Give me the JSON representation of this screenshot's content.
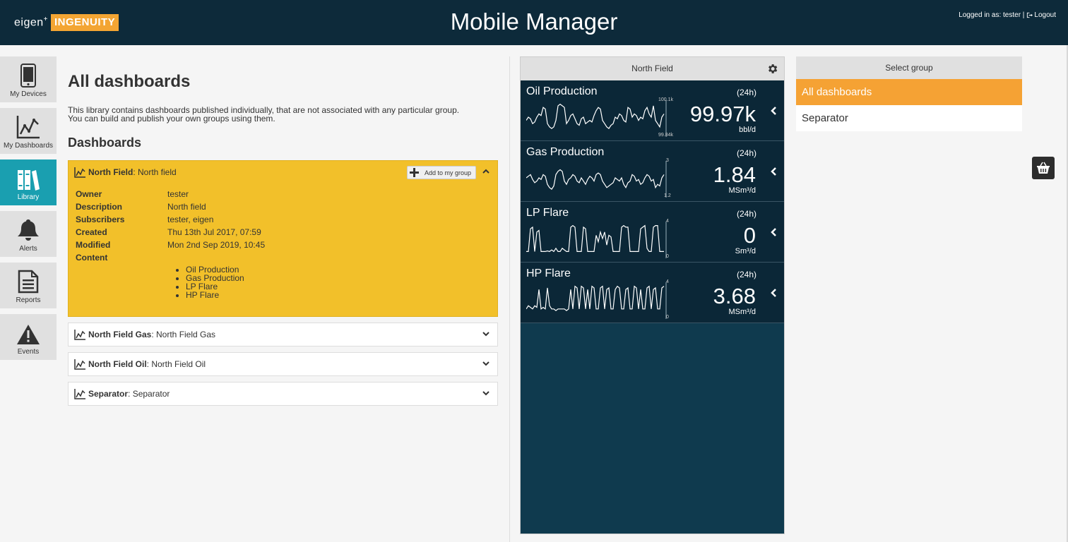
{
  "header": {
    "logo_eigen": "eigen",
    "logo_plus": "+",
    "logo_ingenuity": "INGENUITY",
    "title": "Mobile Manager",
    "logged_in_text": "Logged in as: tester |",
    "logout_label": "Logout"
  },
  "sidebar": {
    "items": [
      {
        "label": "My Devices",
        "icon": "phone-icon",
        "active": false
      },
      {
        "label": "My Dashboards",
        "icon": "line-chart-icon",
        "active": false
      },
      {
        "label": "Library",
        "icon": "books-icon",
        "active": true
      },
      {
        "label": "Alerts",
        "icon": "bell-icon",
        "active": false
      },
      {
        "label": "Reports",
        "icon": "document-icon",
        "active": false
      },
      {
        "label": "Events",
        "icon": "warning-icon",
        "active": false
      }
    ]
  },
  "library": {
    "title": "All dashboards",
    "description_line1": "This library contains dashboards published individually, that are not associated with any particular group.",
    "description_line2": "You can build and publish your own groups using them.",
    "subtitle": "Dashboards",
    "expanded": {
      "name": "North Field",
      "desc": ": North field",
      "add_button": "Add to my group",
      "details": [
        {
          "label": "Owner",
          "value": "tester"
        },
        {
          "label": "Description",
          "value": "North field"
        },
        {
          "label": "Subscribers",
          "value": "tester, eigen"
        },
        {
          "label": "Created",
          "value": "Thu 13th Jul 2017, 07:59"
        },
        {
          "label": "Modified",
          "value": "Mon 2nd Sep 2019, 10:45"
        },
        {
          "label": "Content",
          "value": ""
        }
      ],
      "content": [
        "Oil Production",
        "Gas Production",
        "LP Flare",
        "HP Flare"
      ]
    },
    "collapsed": [
      {
        "name": "North Field Gas",
        "desc": ": North Field Gas"
      },
      {
        "name": "North Field Oil",
        "desc": ": North Field Oil"
      },
      {
        "name": "Separator",
        "desc": ": Separator"
      }
    ]
  },
  "preview": {
    "title": "North Field",
    "widgets": [
      {
        "title": "Oil Production",
        "period": "(24h)",
        "value": "99.97k",
        "unit": "bbl/d",
        "tick_max": "100.1k",
        "tick_min": "99.84k",
        "spark": [
          0.4,
          0.5,
          0.45,
          0.3,
          0.35,
          0.5,
          0.6,
          0.55,
          0.8,
          0.75,
          0.3,
          0.2,
          0.15,
          0.2,
          0.4,
          0.85,
          0.9,
          0.85,
          0.8,
          0.3,
          0.4,
          0.55,
          0.6,
          0.45,
          0.3,
          0.25,
          0.45,
          0.5,
          0.3,
          0.35,
          0.4,
          0.35,
          0.55,
          0.7,
          0.8,
          0.75,
          0.4,
          0.3,
          0.2,
          0.15,
          0.25,
          0.3,
          0.5,
          0.45,
          0.6,
          0.55,
          0.4,
          0.35,
          0.8,
          0.75,
          0.5,
          0.6,
          0.55,
          0.4,
          0.5,
          0.45,
          0.7,
          0.8,
          0.6,
          0.5,
          0.85,
          0.4,
          0.3,
          0.2,
          0.5,
          0.6
        ]
      },
      {
        "title": "Gas Production",
        "period": "(24h)",
        "value": "1.84",
        "unit": "MSm³/d",
        "tick_max": "3",
        "tick_min": "1.2",
        "spark": [
          0.5,
          0.55,
          0.6,
          0.45,
          0.35,
          0.4,
          0.5,
          0.45,
          0.6,
          0.55,
          0.3,
          0.2,
          0.15,
          0.25,
          0.6,
          0.7,
          0.75,
          0.7,
          0.4,
          0.3,
          0.45,
          0.5,
          0.6,
          0.55,
          0.4,
          0.35,
          0.5,
          0.4,
          0.3,
          0.45,
          0.55,
          0.5,
          0.4,
          0.6,
          0.65,
          0.6,
          0.4,
          0.3,
          0.2,
          0.25,
          0.3,
          0.35,
          0.5,
          0.45,
          0.4,
          0.5,
          0.3,
          0.2,
          0.35,
          0.4,
          0.6,
          0.55,
          0.4,
          0.45,
          0.3,
          0.35,
          0.5,
          0.6,
          0.55,
          0.4,
          0.45,
          0.2,
          0.3,
          0.25,
          0.5,
          0.6
        ]
      },
      {
        "title": "LP Flare",
        "period": "(24h)",
        "value": "0",
        "unit": "Sm³/d",
        "tick_max": "4",
        "tick_min": "0",
        "spark": [
          0.1,
          0.1,
          0.8,
          0.85,
          0.1,
          0.7,
          0.75,
          0.1,
          0.1,
          0.1,
          0.12,
          0.1,
          0.15,
          0.1,
          0.2,
          0.1,
          0.1,
          0.2,
          0.15,
          0.1,
          0.1,
          0.85,
          0.9,
          0.85,
          0.1,
          0.1,
          0.1,
          0.85,
          0.8,
          0.1,
          0.1,
          0.1,
          0.1,
          0.6,
          0.4,
          0.7,
          0.5,
          0.7,
          0.3,
          0.6,
          0.55,
          0.1,
          0.1,
          0.1,
          0.1,
          0.85,
          0.9,
          0.85,
          0.85,
          0.1,
          0.1,
          0.1,
          0.1,
          0.1,
          0.8,
          0.85,
          0.9,
          0.2,
          0.1,
          0.1,
          0.85,
          0.9,
          0.9,
          0.1,
          0.1,
          0.1
        ]
      },
      {
        "title": "HP Flare",
        "period": "(24h)",
        "value": "3.68",
        "unit": "MSm³/d",
        "tick_max": "4",
        "tick_min": "0",
        "spark": [
          0.2,
          0.3,
          0.25,
          0.2,
          0.3,
          0.25,
          0.8,
          0.2,
          0.25,
          0.2,
          0.85,
          0.3,
          0.2,
          0.2,
          0.15,
          0.2,
          0.2,
          0.2,
          0.2,
          0.15,
          0.2,
          0.8,
          0.2,
          0.9,
          0.85,
          0.2,
          0.9,
          0.85,
          0.2,
          0.8,
          0.2,
          0.9,
          0.85,
          0.2,
          0.2,
          0.85,
          0.9,
          0.2,
          0.8,
          0.85,
          0.2,
          0.2,
          0.8,
          0.9,
          0.85,
          0.2,
          0.2,
          0.8,
          0.85,
          0.2,
          0.2,
          0.9,
          0.85,
          0.2,
          0.8,
          0.2,
          0.2,
          0.85,
          0.9,
          0.2,
          0.8,
          0.85,
          0.2,
          0.2,
          0.85,
          0.9
        ]
      }
    ]
  },
  "groups": {
    "header": "Select group",
    "items": [
      {
        "label": "All dashboards",
        "selected": true
      },
      {
        "label": "Separator",
        "selected": false
      }
    ]
  },
  "colors": {
    "header_bg": "#0d2a3a",
    "accent_orange": "#f5a234",
    "accent_teal": "#1a9fb0",
    "expanded_card": "#f2c02a"
  }
}
